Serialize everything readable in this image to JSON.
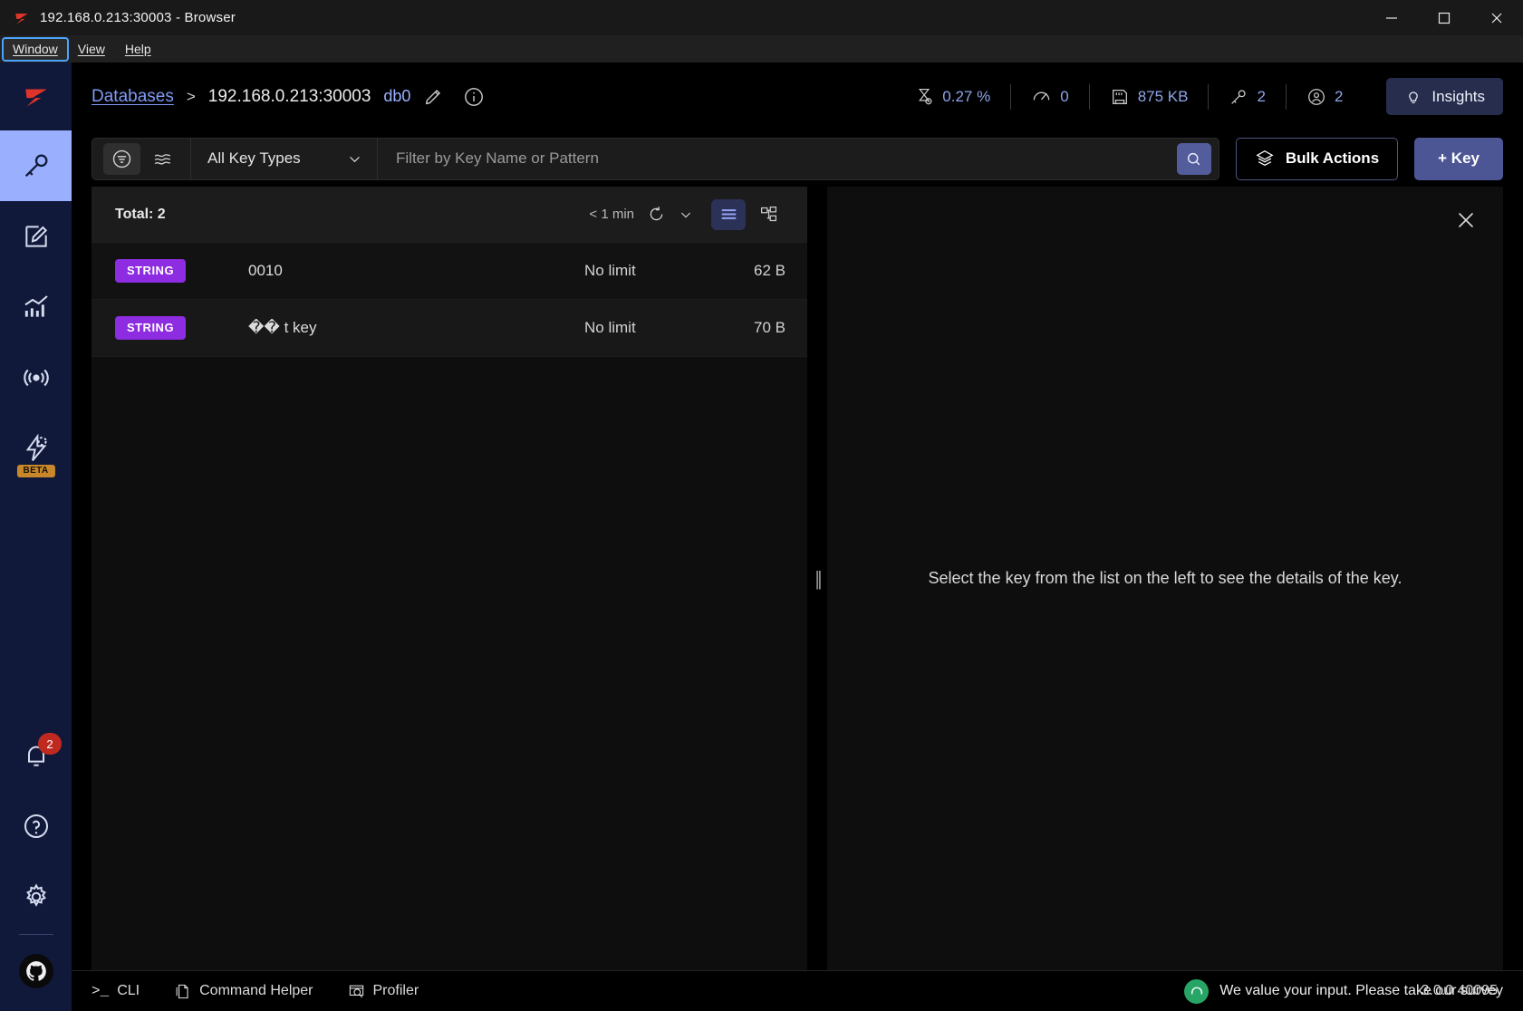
{
  "window": {
    "title": "192.168.0.213:30003 - Browser",
    "logo_icon": "redis-logo-icon",
    "minimize_label": "─",
    "maximize_label": "☐",
    "close_label": "✕"
  },
  "menubar": {
    "items": [
      {
        "label": "Window",
        "mnemonic": "W",
        "focused": true
      },
      {
        "label": "View",
        "mnemonic": "V",
        "focused": false
      },
      {
        "label": "Help",
        "mnemonic": "H",
        "focused": false
      }
    ]
  },
  "sidebar": {
    "logo_icon": "redis-logo-icon",
    "items": [
      {
        "name": "browser",
        "icon": "key-icon",
        "active": true,
        "badge": null
      },
      {
        "name": "workbench",
        "icon": "edit-square-icon",
        "active": false,
        "badge": null
      },
      {
        "name": "analytics",
        "icon": "bar-chart-icon",
        "active": false,
        "badge": null
      },
      {
        "name": "pubsub",
        "icon": "broadcast-icon",
        "active": false,
        "badge": null
      },
      {
        "name": "triggers-and-functions",
        "icon": "lightning-gear-icon",
        "active": false,
        "badge": "BETA"
      }
    ],
    "bottom_items": [
      {
        "name": "notifications",
        "icon": "bell-icon",
        "badge": "2"
      },
      {
        "name": "help",
        "icon": "question-circle-icon",
        "badge": null
      },
      {
        "name": "settings",
        "icon": "gear-icon",
        "badge": null
      },
      {
        "name": "github",
        "icon": "github-icon",
        "badge": null
      }
    ]
  },
  "header": {
    "breadcrumb_root": "Databases",
    "breadcrumb_separator": ">",
    "breadcrumb_current": "192.168.0.213:30003",
    "database_name": "db0",
    "edit_icon": "pencil-icon",
    "info_icon": "info-circle-icon",
    "stats": [
      {
        "name": "cpu",
        "icon": "hourglass-icon",
        "value": "0.27 %"
      },
      {
        "name": "commands-per-second",
        "icon": "speedometer-icon",
        "value": "0"
      },
      {
        "name": "memory",
        "icon": "memory-card-icon",
        "value": "875 KB"
      },
      {
        "name": "keys",
        "icon": "key-icon",
        "value": "2"
      },
      {
        "name": "connected-clients",
        "icon": "user-circle-icon",
        "value": "2"
      }
    ],
    "insights_label": "Insights",
    "insights_icon": "lightbulb-icon"
  },
  "toolbar": {
    "filter_icon": "filter-circle-icon",
    "scan_icon": "layers-wave-icon",
    "key_type_selected": "All Key Types",
    "key_type_chevron": "chevron-down-icon",
    "filter_placeholder": "Filter by Key Name or Pattern",
    "filter_value": "",
    "search_icon": "search-icon",
    "bulk_actions_label": "Bulk Actions",
    "bulk_actions_icon": "layers-icon",
    "add_key_label": "+ Key"
  },
  "keylist": {
    "total_label": "Total: 2",
    "refresh_text": "< 1 min",
    "refresh_icon": "refresh-icon",
    "refresh_chevron": "chevron-down-icon",
    "view_list_icon": "list-view-icon",
    "view_tree_icon": "tree-view-icon",
    "rows": [
      {
        "type": "STRING",
        "key": "0010",
        "ttl": "No limit",
        "size": "62 B"
      },
      {
        "type": "STRING",
        "key": "�� t key",
        "ttl": "No limit",
        "size": "70 B"
      }
    ]
  },
  "details": {
    "empty_message": "Select the key from the list on the left to see the details of the key.",
    "close_icon": "close-icon"
  },
  "bottombar": {
    "items": [
      {
        "label": "CLI",
        "icon": "terminal-icon"
      },
      {
        "label": "Command Helper",
        "icon": "document-icon"
      },
      {
        "label": "Profiler",
        "icon": "profiler-icon"
      }
    ],
    "survey_icon": "survey-smiley-icon",
    "survey_text": "We value your input. Please take our survey",
    "version_text": "3.0.0  40095"
  },
  "colors": {
    "accent_blue": "#4d5694",
    "sidebar_bg": "#10193a",
    "sidebar_active": "#9ab0ff",
    "badge_purple": "#8d2ce0",
    "badge_red": "#bf2a20",
    "beta_orange": "#c8872a",
    "link_blue": "#7f9bf5"
  }
}
